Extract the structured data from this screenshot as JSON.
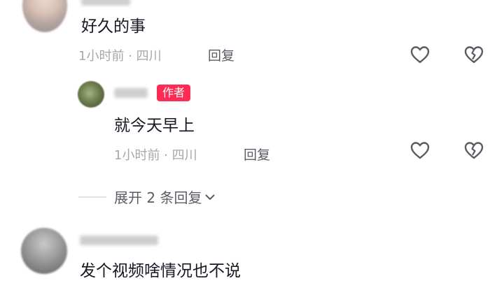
{
  "comments": [
    {
      "text": "好久的事",
      "time_location": "1小时前 · 四川",
      "reply_label": "回复"
    },
    {
      "author_tag": "作者",
      "text": "就今天早上",
      "time_location": "1小时前 · 四川",
      "reply_label": "回复"
    },
    {
      "text": "发个视频啥情况也不说"
    }
  ],
  "expand_replies": {
    "label": "展开 2 条回复"
  },
  "icons": {
    "like": "heart-outline-icon",
    "dislike": "broken-heart-icon",
    "expand": "chevron-down-icon"
  },
  "colors": {
    "author_tag_bg": "#fe2c55",
    "meta_text": "#a7a7ab"
  }
}
